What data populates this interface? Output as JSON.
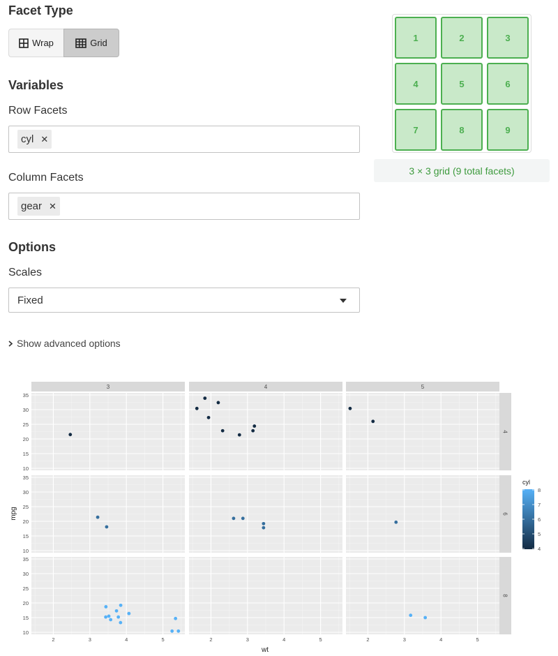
{
  "facet_type": {
    "heading": "Facet Type",
    "wrap_label": "Wrap",
    "grid_label": "Grid",
    "selected": "Grid"
  },
  "variables": {
    "heading": "Variables",
    "row_facets_label": "Row Facets",
    "row_facets": [
      "cyl"
    ],
    "column_facets_label": "Column Facets",
    "column_facets": [
      "gear"
    ]
  },
  "options": {
    "heading": "Options",
    "scales_label": "Scales",
    "scales_value": "Fixed",
    "advanced_label": "Show advanced options"
  },
  "preview": {
    "cells": [
      "1",
      "2",
      "3",
      "4",
      "5",
      "6",
      "7",
      "8",
      "9"
    ],
    "caption": "3 × 3 grid (9 total facets)",
    "accent": "#4caf50"
  },
  "chart_data": {
    "type": "scatter",
    "xlabel": "wt",
    "ylabel": "mpg",
    "xlim": [
      1.4,
      5.6
    ],
    "ylim": [
      10,
      35
    ],
    "xticks": [
      2,
      3,
      4,
      5
    ],
    "yticks": [
      10,
      15,
      20,
      25,
      30,
      35
    ],
    "grid": true,
    "col_strips": [
      "3",
      "4",
      "5"
    ],
    "row_strips": [
      "4",
      "6",
      "8"
    ],
    "legend": {
      "title": "cyl",
      "ticks": [
        "8",
        "7",
        "6",
        "5",
        "4"
      ],
      "low_color": "#132b43",
      "high_color": "#56b1f7",
      "position": "right"
    },
    "panels": [
      {
        "row": "4",
        "col": "3",
        "x": [
          2.465
        ],
        "y": [
          21.5
        ]
      },
      {
        "row": "4",
        "col": "4",
        "x": [
          2.32,
          3.19,
          3.15,
          2.2,
          1.615,
          1.835,
          1.935,
          2.78
        ],
        "y": [
          22.8,
          24.4,
          22.8,
          32.4,
          30.4,
          33.9,
          27.3,
          21.4
        ]
      },
      {
        "row": "4",
        "col": "5",
        "x": [
          2.14,
          1.513
        ],
        "y": [
          26.0,
          30.4
        ]
      },
      {
        "row": "6",
        "col": "3",
        "x": [
          3.215,
          3.46
        ],
        "y": [
          21.4,
          18.1
        ]
      },
      {
        "row": "6",
        "col": "4",
        "x": [
          2.62,
          2.875,
          3.44,
          3.44
        ],
        "y": [
          21.0,
          21.0,
          19.2,
          17.8
        ]
      },
      {
        "row": "6",
        "col": "5",
        "x": [
          2.77
        ],
        "y": [
          19.7
        ]
      },
      {
        "row": "8",
        "col": "3",
        "x": [
          3.44,
          3.57,
          4.07,
          3.73,
          3.78,
          5.25,
          5.424,
          5.345,
          3.52,
          3.435,
          3.84,
          3.845
        ],
        "y": [
          18.7,
          14.3,
          16.4,
          17.3,
          15.2,
          10.4,
          10.4,
          14.7,
          15.5,
          15.2,
          13.3,
          19.2
        ]
      },
      {
        "row": "8",
        "col": "4",
        "x": [],
        "y": []
      },
      {
        "row": "8",
        "col": "5",
        "x": [
          3.17,
          3.57
        ],
        "y": [
          15.8,
          15.0
        ]
      }
    ]
  }
}
